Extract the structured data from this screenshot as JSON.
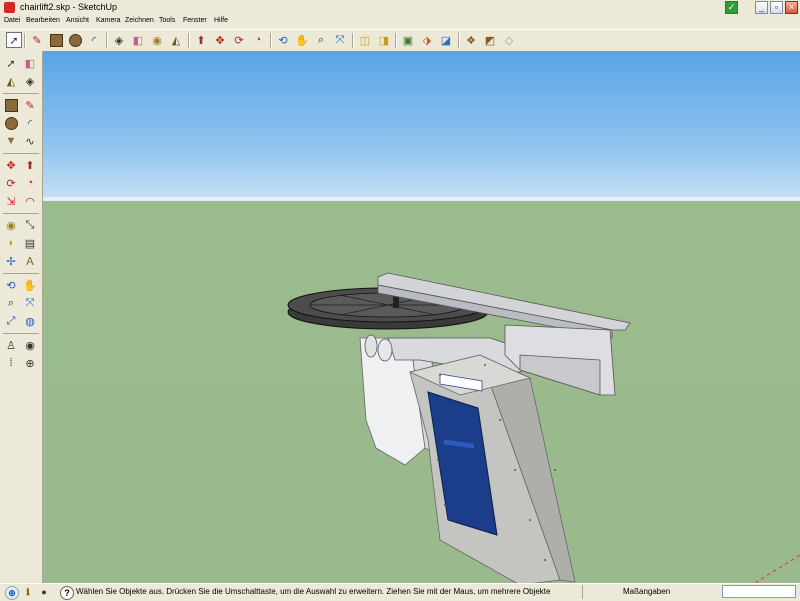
{
  "window": {
    "title": "chairlift2.skp - SketchUp"
  },
  "menu": [
    "Datei",
    "Bearbeiten",
    "Ansicht",
    "Kamera",
    "Zeichnen",
    "Tools",
    "Fenster",
    "Hilfe"
  ],
  "toolbar_icons": [
    "select-tool-icon",
    "line-tool-icon",
    "rectangle-tool-icon",
    "circle-tool-icon",
    "arc-tool-icon",
    "make-component-icon",
    "eraser-tool-icon",
    "tape-measure-icon",
    "paint-bucket-icon",
    "push-pull-tool-icon",
    "move-tool-icon",
    "rotate-tool-icon",
    "follow-me-tool-icon",
    "orbit-tool-icon",
    "pan-tool-icon",
    "zoom-tool-icon",
    "zoom-extents-icon",
    "previous-view-icon",
    "next-view-icon",
    "get-models-icon",
    "share-model-icon",
    "place-model-icon",
    "components-icon",
    "materials-icon",
    "styles-icon"
  ],
  "left_toolbar_icons": [
    "select-tool-icon",
    "eraser-tool-icon",
    "paint-bucket-icon",
    "make-component-icon",
    "rectangle-tool-icon",
    "line-tool-icon",
    "circle-tool-icon",
    "arc-tool-icon",
    "polygon-tool-icon",
    "freehand-tool-icon",
    "move-tool-icon",
    "push-pull-tool-icon",
    "rotate-tool-icon",
    "follow-me-tool-icon",
    "scale-tool-icon",
    "offset-tool-icon",
    "tape-measure-icon",
    "dimension-tool-icon",
    "protractor-tool-icon",
    "text-tool-icon",
    "axes-tool-icon",
    "3d-text-tool-icon",
    "orbit-tool-icon",
    "pan-tool-icon",
    "zoom-tool-icon",
    "zoom-window-icon",
    "zoom-extents-icon",
    "previous-view-icon",
    "position-camera-icon",
    "look-around-icon",
    "walk-tool-icon",
    "section-plane-icon"
  ],
  "status": {
    "text": "Wählen Sie Objekte aus. Drücken Sie die Umschalttaste, um die Auswahl zu erweitern. Ziehen Sie mit der Maus, um mehrere Objekte",
    "measure_label": "Maßangaben",
    "measure_value": ""
  },
  "colors": {
    "sky_top": "#57a4e6",
    "ground": "#9ab98d",
    "concrete": "#c4c4c0",
    "panel_blue": "#1c3e8a",
    "chrome": "#ece9d8"
  }
}
